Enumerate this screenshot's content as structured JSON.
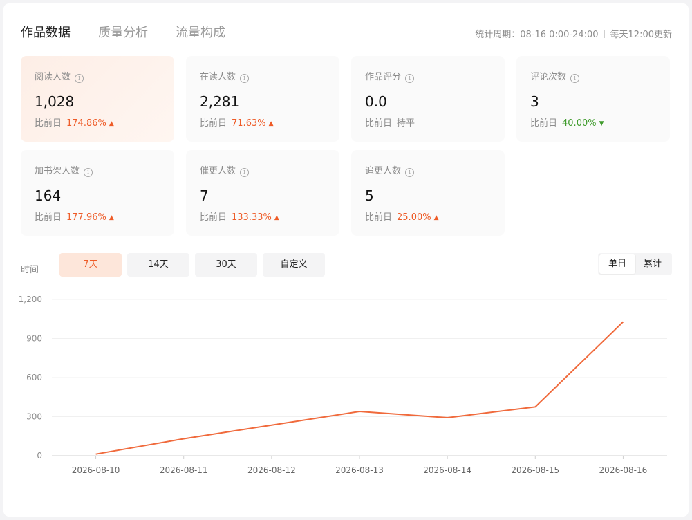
{
  "tabs": [
    {
      "label": "作品数据",
      "active": true
    },
    {
      "label": "质量分析",
      "active": false
    },
    {
      "label": "流量构成",
      "active": false
    }
  ],
  "period": {
    "range": "统计周期：08-16 0:00-24:00",
    "update": "每天12:00更新"
  },
  "compare_label": "比前日",
  "info_glyph": "i",
  "cards": [
    {
      "label": "阅读人数",
      "value": "1,028",
      "change": "174.86%",
      "trend": "up",
      "trend_icon": "▲"
    },
    {
      "label": "在读人数",
      "value": "2,281",
      "change": "71.63%",
      "trend": "up",
      "trend_icon": "▲"
    },
    {
      "label": "作品评分",
      "value": "0.0",
      "change": "持平",
      "trend": "flat",
      "trend_icon": ""
    },
    {
      "label": "评论次数",
      "value": "3",
      "change": "40.00%",
      "trend": "down",
      "trend_icon": "▼"
    },
    {
      "label": "加书架人数",
      "value": "164",
      "change": "177.96%",
      "trend": "up",
      "trend_icon": "▲"
    },
    {
      "label": "催更人数",
      "value": "7",
      "change": "133.33%",
      "trend": "up",
      "trend_icon": "▲"
    },
    {
      "label": "追更人数",
      "value": "5",
      "change": "25.00%",
      "trend": "up",
      "trend_icon": "▲"
    }
  ],
  "time_filter": {
    "label": "时间",
    "options": [
      {
        "label": "7天",
        "active": true
      },
      {
        "label": "14天",
        "active": false
      },
      {
        "label": "30天",
        "active": false
      },
      {
        "label": "自定义",
        "active": false
      }
    ]
  },
  "mode_switch": {
    "options": [
      {
        "label": "单日",
        "active": true
      },
      {
        "label": "累计",
        "active": false
      }
    ]
  },
  "colors": {
    "accent": "#ee5b27",
    "up": "#ee5b27",
    "down": "#3f9b2c",
    "line": "#f06a3c"
  },
  "chart_data": {
    "type": "line",
    "x": [
      "2026-08-10",
      "2026-08-11",
      "2026-08-12",
      "2026-08-13",
      "2026-08-14",
      "2026-08-15",
      "2026-08-16"
    ],
    "series": [
      {
        "values": [
          12,
          130,
          235,
          340,
          292,
          375,
          1028
        ]
      }
    ],
    "yticks": [
      "0",
      "300",
      "600",
      "900",
      "1,200"
    ],
    "ylim": [
      0,
      1200
    ],
    "grid": true,
    "legend": "none"
  }
}
